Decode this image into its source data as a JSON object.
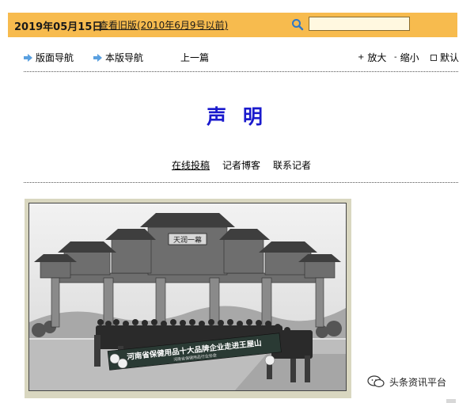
{
  "header": {
    "date": "2019年05月15日",
    "old_edition_link": "查看旧版(2010年6月9号以前)",
    "search": {
      "value": ""
    }
  },
  "nav": {
    "layout_nav": "版面导航",
    "this_page_nav": "本版导航",
    "prev_article": "上一篇",
    "zoom_in": "放大",
    "zoom_out": "缩小",
    "default_size": "默认"
  },
  "article": {
    "title": "声 明"
  },
  "links": {
    "submit": "在线投稿",
    "reporter_blog": "记者博客",
    "contact_reporter": "联系记者"
  },
  "photo": {
    "gate_plaque": "天润一幕",
    "banner_main": "河南省保健用品十大品牌企业走进王屋山",
    "banner_sub": "河南省保健用品行业协会"
  },
  "watermark": {
    "text": "头条资讯平台"
  },
  "colors": {
    "topbar": "#f7bb4e",
    "title": "#1a1acd",
    "arrow_icon": "#5aa0e0"
  }
}
